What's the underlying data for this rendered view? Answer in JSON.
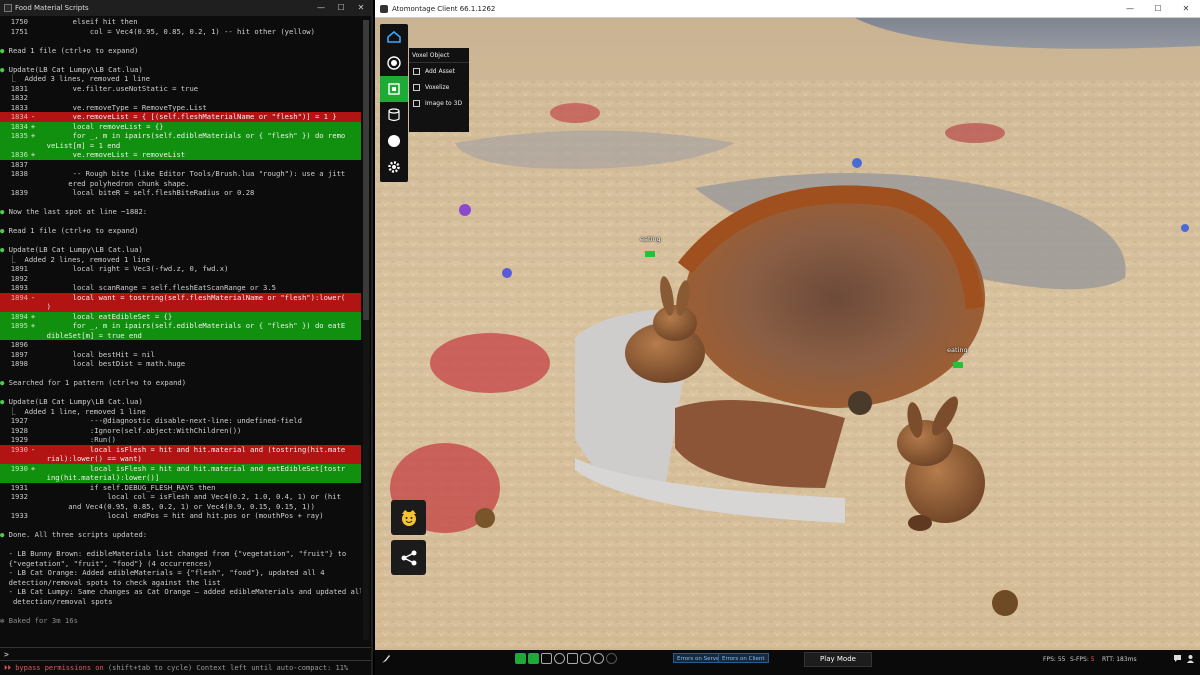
{
  "terminal": {
    "title": "Food Material Scripts",
    "lines": [
      {
        "t": "code",
        "n": "1750",
        "c": "        elseif hit then"
      },
      {
        "t": "code",
        "n": "1751",
        "c": "            col = Vec4(0.95, 0.85, 0.2, 1) -- hit other (yellow)"
      },
      {
        "t": "blank",
        "c": ""
      },
      {
        "t": "bul",
        "c": "Read 1 file (ctrl+o to expand)"
      },
      {
        "t": "blank",
        "c": ""
      },
      {
        "t": "bul",
        "c": "Update(LB Cat Lumpy\\LB Cat.lua)"
      },
      {
        "t": "sub",
        "c": "  ⎿  Added 3 lines, removed 1 line"
      },
      {
        "t": "code",
        "n": "1831",
        "c": "        ve.filter.useNotStatic = true"
      },
      {
        "t": "code",
        "n": "1832",
        "c": ""
      },
      {
        "t": "code",
        "n": "1833",
        "c": "        ve.removeType = RemoveType.List"
      },
      {
        "t": "rem",
        "n": "1834",
        "s": "-",
        "c": "        ve.removeList = { [(self.fleshMaterialName or \"flesh\")] = 1 }"
      },
      {
        "t": "add",
        "n": "1834",
        "s": "+",
        "c": "        local removeList = {}"
      },
      {
        "t": "add",
        "n": "1835",
        "s": "+",
        "c": "        for _, m in ipairs(self.edibleMaterials or { \"flesh\" }) do remo"
      },
      {
        "t": "add",
        "n": "",
        "s": "",
        "c": "  veList[m] = 1 end"
      },
      {
        "t": "add",
        "n": "1836",
        "s": "+",
        "c": "        ve.removeList = removeList"
      },
      {
        "t": "code",
        "n": "1837",
        "c": ""
      },
      {
        "t": "code",
        "n": "1838",
        "c": "        -- Rough bite (like Editor Tools/Brush.lua \"rough\"): use a jitt"
      },
      {
        "t": "code",
        "n": "",
        "c": "       ered polyhedron chunk shape."
      },
      {
        "t": "code",
        "n": "1839",
        "c": "        local biteR = self.fleshBiteRadius or 0.28"
      },
      {
        "t": "blank",
        "c": ""
      },
      {
        "t": "bul",
        "c": "Now the last spot at line ~1882:"
      },
      {
        "t": "blank",
        "c": ""
      },
      {
        "t": "bul",
        "c": "Read 1 file (ctrl+o to expand)"
      },
      {
        "t": "blank",
        "c": ""
      },
      {
        "t": "bul",
        "c": "Update(LB Cat Lumpy\\LB Cat.lua)"
      },
      {
        "t": "sub",
        "c": "  ⎿  Added 2 lines, removed 1 line"
      },
      {
        "t": "code",
        "n": "1891",
        "c": "        local right = Vec3(-fwd.z, 0, fwd.x)"
      },
      {
        "t": "code",
        "n": "1892",
        "c": ""
      },
      {
        "t": "code",
        "n": "1893",
        "c": "        local scanRange = self.fleshEatScanRange or 3.5"
      },
      {
        "t": "rem",
        "n": "1894",
        "s": "-",
        "c": "        local want = tostring(self.fleshMaterialName or \"flesh\"):lower("
      },
      {
        "t": "rem",
        "n": "",
        "s": "",
        "c": "  )"
      },
      {
        "t": "add",
        "n": "1894",
        "s": "+",
        "c": "        local eatEdibleSet = {}"
      },
      {
        "t": "add",
        "n": "1895",
        "s": "+",
        "c": "        for _, m in ipairs(self.edibleMaterials or { \"flesh\" }) do eatE"
      },
      {
        "t": "add",
        "n": "",
        "s": "",
        "c": "  dibleSet[m] = true end"
      },
      {
        "t": "code",
        "n": "1896",
        "c": ""
      },
      {
        "t": "code",
        "n": "1897",
        "c": "        local bestHit = nil"
      },
      {
        "t": "code",
        "n": "1898",
        "c": "        local bestDist = math.huge"
      },
      {
        "t": "blank",
        "c": ""
      },
      {
        "t": "bul",
        "c": "Searched for 1 pattern (ctrl+o to expand)"
      },
      {
        "t": "blank",
        "c": ""
      },
      {
        "t": "bul",
        "c": "Update(LB Cat Lumpy\\LB Cat.lua)"
      },
      {
        "t": "sub",
        "c": "  ⎿  Added 1 line, removed 1 line"
      },
      {
        "t": "code",
        "n": "1927",
        "c": "            ---@diagnostic disable-next-line: undefined-field"
      },
      {
        "t": "code",
        "n": "1928",
        "c": "            :Ignore(self.object:WithChildren())"
      },
      {
        "t": "code",
        "n": "1929",
        "c": "            :Run()"
      },
      {
        "t": "rem",
        "n": "1930",
        "s": "-",
        "c": "            local isFlesh = hit and hit.material and (tostring(hit.mate"
      },
      {
        "t": "rem",
        "n": "",
        "s": "",
        "c": "  rial):lower() == want)"
      },
      {
        "t": "add",
        "n": "1930",
        "s": "+",
        "c": "            local isFlesh = hit and hit.material and eatEdibleSet[tostr"
      },
      {
        "t": "add",
        "n": "",
        "s": "",
        "c": "  ing(hit.material):lower()]"
      },
      {
        "t": "code",
        "n": "1931",
        "c": "            if self.DEBUG_FLESH_RAYS then"
      },
      {
        "t": "code",
        "n": "1932",
        "c": "                local col = isFlesh and Vec4(0.2, 1.0, 0.4, 1) or (hit"
      },
      {
        "t": "code",
        "n": "",
        "c": "       and Vec4(0.95, 0.85, 0.2, 1) or Vec4(0.9, 0.15, 0.15, 1))"
      },
      {
        "t": "code",
        "n": "1933",
        "c": "                local endPos = hit and hit.pos or (mouthPos + ray)"
      },
      {
        "t": "blank",
        "c": ""
      },
      {
        "t": "bul",
        "c": "Done. All three scripts updated:"
      },
      {
        "t": "blank",
        "c": ""
      },
      {
        "t": "txt",
        "c": "  - LB Bunny Brown: edibleMaterials list changed from {\"vegetation\", \"fruit\"} to"
      },
      {
        "t": "txt",
        "c": "  {\"vegetation\", \"fruit\", \"food\"} (4 occurrences)"
      },
      {
        "t": "txt",
        "c": "  - LB Cat Orange: Added edibleMaterials = {\"flesh\", \"food\"}, updated all 4"
      },
      {
        "t": "txt",
        "c": "  detection/removal spots to check against the list"
      },
      {
        "t": "txt",
        "c": "  - LB Cat Lumpy: Same changes as Cat Orange — added edibleMaterials and updated all 4"
      },
      {
        "t": "txt",
        "c": "   detection/removal spots"
      },
      {
        "t": "blank",
        "c": ""
      },
      {
        "t": "baked",
        "c": "✻ Baked for 3m 16s"
      }
    ],
    "prompt": ">",
    "status_warn": "⏵⏵ bypass permissions on",
    "status_rest": " (shift+tab to cycle) Context left until auto-compact: 11%"
  },
  "game": {
    "title": "Atomontage Client 66.1.1262",
    "menu": {
      "header": "Voxel Object",
      "items": [
        "Add Asset",
        "Voxelize",
        "Image to 3D"
      ]
    },
    "labels": [
      "eating",
      "eating"
    ],
    "bottom": {
      "errors_server": "Errors on Server",
      "errors_client": "Errors on Client",
      "play_mode": "Play Mode",
      "fps_label": "FPS:",
      "fps": "55",
      "sfps_label": "S-FPS:",
      "sfps": "5",
      "rtt": "RTT: 183ms"
    }
  }
}
